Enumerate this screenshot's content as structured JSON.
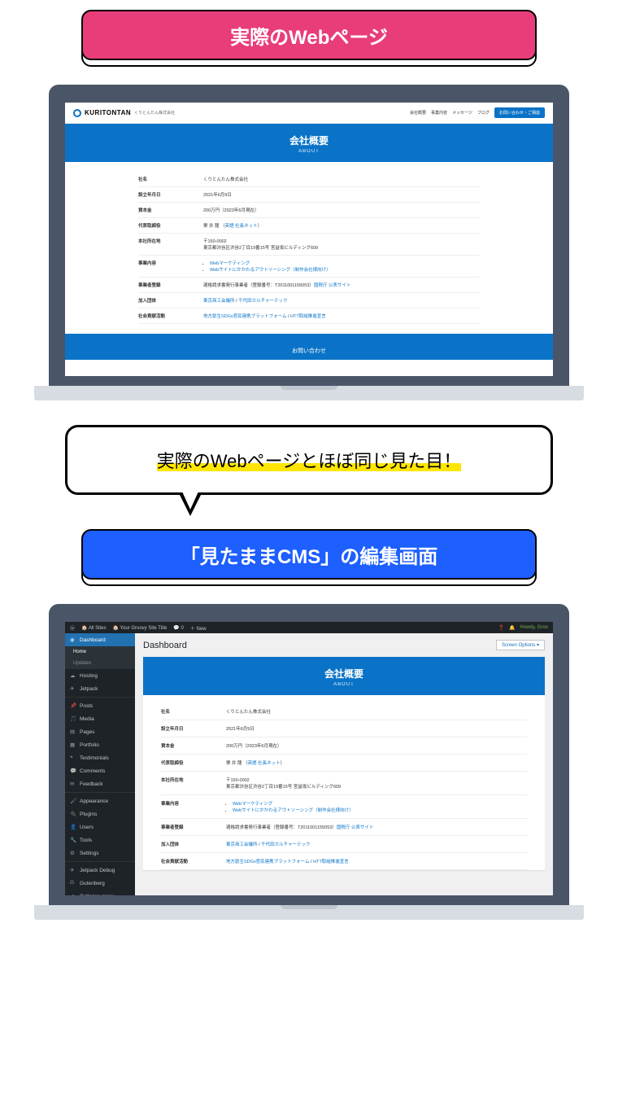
{
  "pink_label": "実際のWebページ",
  "bubble_text": "実際のWebページとほぼ同じ見た目！",
  "blue_label": "「見たままCMS」の編集画面",
  "site": {
    "logo": "KURITONTAN",
    "logo_sub": "くりとんたん株式会社",
    "nav": [
      "会社概要",
      "事業内容",
      "メッセージ",
      "ブログ"
    ],
    "nav_btn": "お問い合わせ・ご相談",
    "hero_title": "会社概要",
    "hero_sub": "ABOUT",
    "footer_text": "お問い合わせ"
  },
  "rows": [
    {
      "label": "社名",
      "value": "くりとんたん株式会社"
    },
    {
      "label": "設立年月日",
      "value": "2021年6月9日"
    },
    {
      "label": "資本金",
      "value": "200万円（2023年6月現在）"
    },
    {
      "label": "代表取締役",
      "value": "栗 井 龍 （",
      "link": "英語 社長ネット",
      "after": "）"
    },
    {
      "label": "本社所在地",
      "value": "〒150-0002\n東京都渋谷区渋谷2丁目19番15号 宮益坂ビルディング609"
    },
    {
      "label": "事業内容",
      "list": [
        "Webマーケティング",
        "Webサイトにかかわるアウトソーシング（制作会社様向け）"
      ]
    },
    {
      "label": "事業者登録",
      "value": "適格請求書発行事業者（登録番号：T2011001155053）",
      "link": "国税庁 公表サイト"
    },
    {
      "label": "加入団体",
      "links": [
        "東京商工会議所",
        "千代田カルチャーテック"
      ]
    },
    {
      "label": "社会貢献活動",
      "links": [
        "地方創生SDGs官民連携プラットフォーム",
        "HTT取組推進宣言"
      ]
    }
  ],
  "wp": {
    "adminbar": {
      "allsites": "All Sites",
      "site": "Your Groovy Site Title",
      "comments": "0",
      "new": "New",
      "howdy": "Howdy, Groo"
    },
    "dashboard_label": "Dashboard",
    "screen_options": "Screen Options",
    "sidebar": [
      {
        "label": "Dashboard",
        "icon": "dash",
        "active": true
      },
      {
        "label": "Home",
        "sub": true,
        "cur": true
      },
      {
        "label": "Updates",
        "sub": true
      },
      {
        "label": "Hosting",
        "icon": "cloud"
      },
      {
        "label": "Jetpack",
        "icon": "jet"
      },
      {
        "label": "Posts",
        "icon": "pin",
        "sep_before": true
      },
      {
        "label": "Media",
        "icon": "media"
      },
      {
        "label": "Pages",
        "icon": "page"
      },
      {
        "label": "Portfolio",
        "icon": "port"
      },
      {
        "label": "Testimonials",
        "icon": "quote"
      },
      {
        "label": "Comments",
        "icon": "comment"
      },
      {
        "label": "Feedback",
        "icon": "feed"
      },
      {
        "label": "Appearance",
        "icon": "brush",
        "sep_before": true
      },
      {
        "label": "Plugins",
        "icon": "plug"
      },
      {
        "label": "Users",
        "icon": "user"
      },
      {
        "label": "Tools",
        "icon": "tool"
      },
      {
        "label": "Settings",
        "icon": "gear"
      },
      {
        "label": "Jetpack Debug",
        "icon": "jet",
        "sep_before": true
      },
      {
        "label": "Gutenberg",
        "icon": "g"
      },
      {
        "label": "Collapse menu",
        "icon": "collapse"
      }
    ]
  }
}
